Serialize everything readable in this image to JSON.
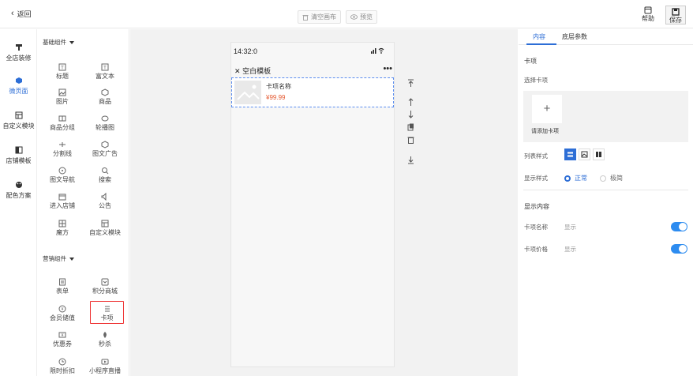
{
  "topbar": {
    "back_label": "返回",
    "clear_label": "清空画布",
    "preview_label": "预览",
    "help_label": "帮助",
    "save_label": "保存"
  },
  "leftnav": [
    "全店装修",
    "微页面",
    "自定义模块",
    "店铺模板",
    "配色方案"
  ],
  "sections": {
    "basic": "基础组件",
    "marketing": "营销组件"
  },
  "basic_components": [
    "标题",
    "富文本",
    "图片",
    "商品",
    "商品分组",
    "轮播图",
    "分割线",
    "图文广告",
    "图文导航",
    "搜索",
    "进入店铺",
    "公告",
    "魔方",
    "自定义模块"
  ],
  "marketing_components": [
    "表单",
    "积分商城",
    "会员储值",
    "卡项",
    "优惠券",
    "秒杀",
    "限时折扣",
    "小程序直播"
  ],
  "phone": {
    "time": "14:32:0",
    "page_title": "空白模板",
    "card_name": "卡项名称",
    "card_price": "¥99.99"
  },
  "panel": {
    "tabs": [
      "内容",
      "底层参数"
    ],
    "section_title": "卡项",
    "select_label": "选择卡项",
    "add_label": "请添加卡项",
    "list_style_label": "列表样式",
    "display_style_label": "显示样式",
    "display_options": [
      "正常",
      "极简"
    ],
    "display_content_label": "显示内容",
    "rows": [
      {
        "label": "卡项名称",
        "value": "显示",
        "on": true
      },
      {
        "label": "卡项价格",
        "value": "显示",
        "on": true
      }
    ]
  },
  "colors": {
    "accent": "#2d6ed6",
    "price": "#e4572e",
    "toggle": "#2d8cf0",
    "highlight": "#e33333"
  }
}
